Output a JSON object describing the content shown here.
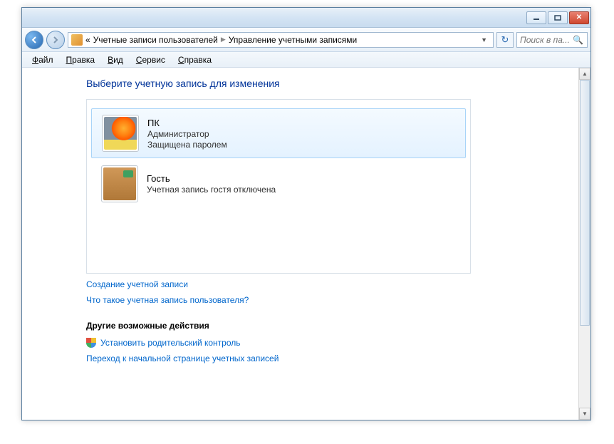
{
  "breadcrumb": {
    "part1": "Учетные записи пользователей",
    "part2": "Управление учетными записями"
  },
  "search": {
    "placeholder": "Поиск в па..."
  },
  "menu": {
    "file": "айл",
    "edit": "равка",
    "view": "ид",
    "tools": "ервис",
    "help": "правка"
  },
  "heading": "Выберите учетную запись для изменения",
  "accounts": [
    {
      "name": "ПК",
      "line1": "Администратор",
      "line2": "Защищена паролем"
    },
    {
      "name": "Гость",
      "line1": "Учетная запись гостя отключена",
      "line2": ""
    }
  ],
  "links": {
    "create": "Создание учетной записи",
    "whatis": "Что такое учетная запись пользователя?"
  },
  "other_section": "Другие возможные действия",
  "other_links": {
    "parental": "Установить родительский контроль",
    "gohome": "Переход к начальной странице учетных записей"
  }
}
